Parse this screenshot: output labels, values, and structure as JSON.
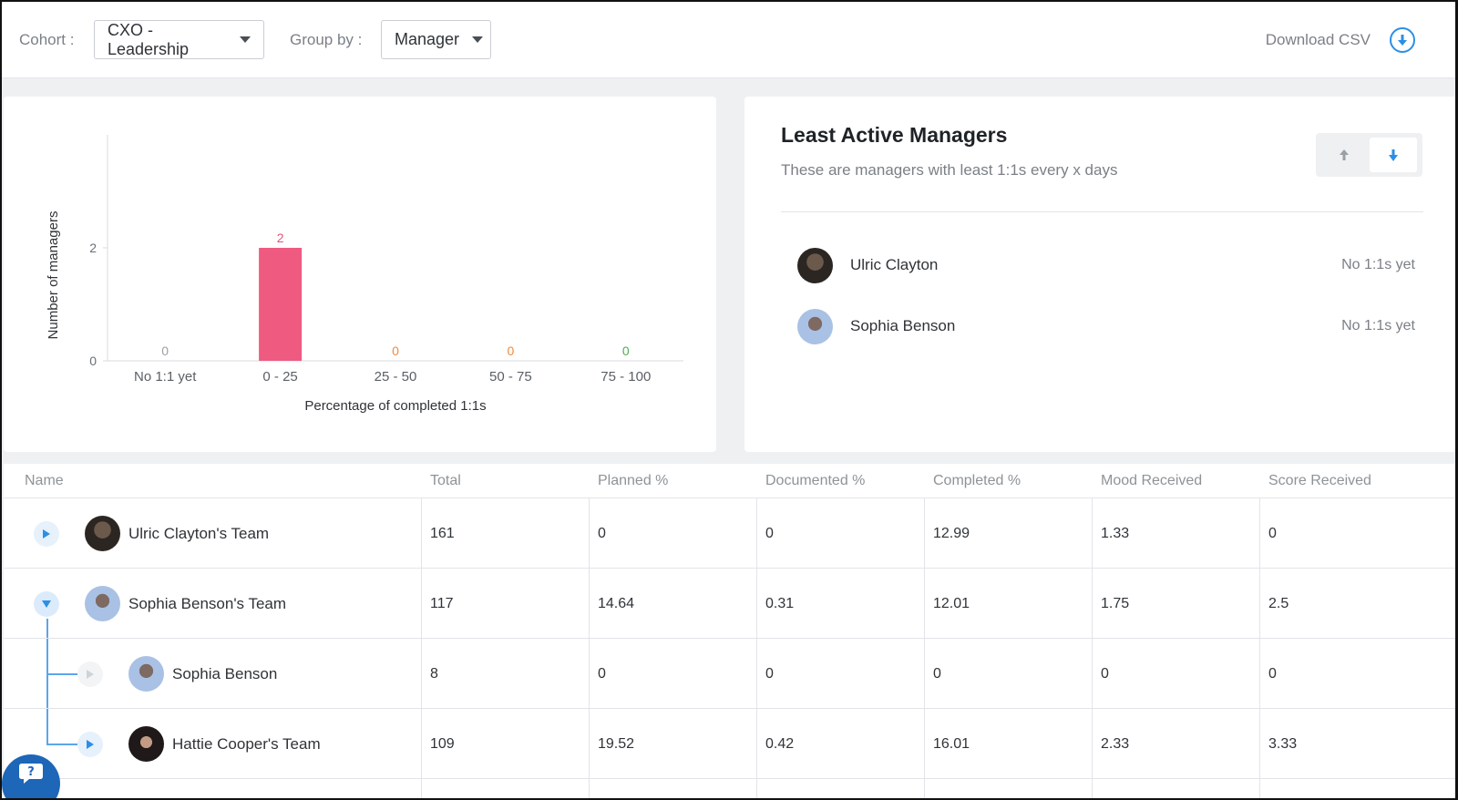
{
  "toolbar": {
    "cohort_label": "Cohort :",
    "cohort_value": "CXO - Leadership",
    "group_label": "Group by :",
    "group_value": "Manager",
    "download_label": "Download CSV"
  },
  "chart_data": {
    "type": "bar",
    "categories": [
      "No 1:1 yet",
      "0 - 25",
      "25 - 50",
      "50 - 75",
      "75 - 100"
    ],
    "values": [
      0,
      2,
      0,
      0,
      0
    ],
    "label_colors": [
      "#9aa0a6",
      "#e0557a",
      "#f08a3e",
      "#f08a3e",
      "#4caf50"
    ],
    "bar_color": "#ef5b80",
    "xlabel": "Percentage of completed 1:1s",
    "ylabel": "Number of managers",
    "yticks": [
      0,
      2
    ],
    "ylim": [
      0,
      4
    ]
  },
  "least_active": {
    "title": "Least Active Managers",
    "subtitle": "These are managers with least 1:1s every x days",
    "managers": [
      {
        "name": "Ulric Clayton",
        "status": "No 1:1s yet"
      },
      {
        "name": "Sophia Benson",
        "status": "No 1:1s yet"
      }
    ]
  },
  "table": {
    "headers": [
      "Name",
      "Total",
      "Planned %",
      "Documented %",
      "Completed %",
      "Mood Received",
      "Score Received"
    ],
    "rows": [
      {
        "name": "Ulric Clayton's Team",
        "values": [
          "161",
          "0",
          "0",
          "12.99",
          "1.33",
          "0"
        ]
      },
      {
        "name": "Sophia Benson's Team",
        "values": [
          "117",
          "14.64",
          "0.31",
          "12.01",
          "1.75",
          "2.5"
        ]
      },
      {
        "name": "Sophia Benson",
        "values": [
          "8",
          "0",
          "0",
          "0",
          "0",
          "0"
        ]
      },
      {
        "name": "Hattie Cooper's Team",
        "values": [
          "109",
          "19.52",
          "0.42",
          "16.01",
          "2.33",
          "3.33"
        ]
      }
    ]
  },
  "colors": {
    "accent": "#2b8fe6",
    "bar": "#ef5b80"
  }
}
